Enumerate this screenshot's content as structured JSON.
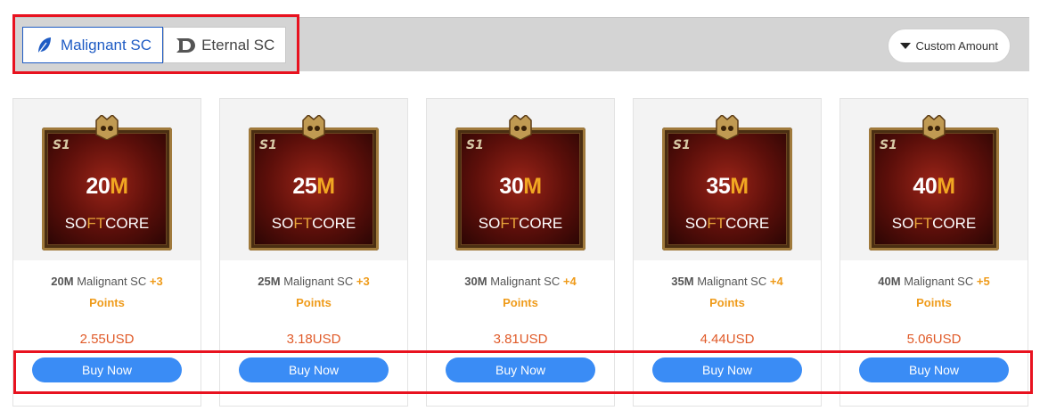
{
  "tabs": [
    {
      "label": "Malignant SC",
      "icon": "leaf-icon",
      "active": true
    },
    {
      "label": "Eternal SC",
      "icon": "diablo-d-icon",
      "active": false
    }
  ],
  "custom_amount": {
    "label": "Custom Amount",
    "icon": "caret-down-icon"
  },
  "colors": {
    "accent": "#3a8cf5",
    "tab_active": "#1f5cc4",
    "price": "#e05a28",
    "points": "#ef9b1a",
    "highlight": "#e8121f"
  },
  "products": [
    {
      "art_season": "S1",
      "art_amount_num": "20",
      "art_amount_unit": "M",
      "art_label_a": "SO",
      "art_label_b": "FT",
      "art_label_c": "CORE",
      "amount": "20M",
      "name": "Malignant SC",
      "bonus": "+3",
      "points_label": "Points",
      "price": "2.55USD",
      "buy_label": "Buy Now"
    },
    {
      "art_season": "S1",
      "art_amount_num": "25",
      "art_amount_unit": "M",
      "art_label_a": "SO",
      "art_label_b": "FT",
      "art_label_c": "CORE",
      "amount": "25M",
      "name": "Malignant SC",
      "bonus": "+3",
      "points_label": "Points",
      "price": "3.18USD",
      "buy_label": "Buy Now"
    },
    {
      "art_season": "S1",
      "art_amount_num": "30",
      "art_amount_unit": "M",
      "art_label_a": "SO",
      "art_label_b": "FT",
      "art_label_c": "CORE",
      "amount": "30M",
      "name": "Malignant SC",
      "bonus": "+4",
      "points_label": "Points",
      "price": "3.81USD",
      "buy_label": "Buy Now"
    },
    {
      "art_season": "S1",
      "art_amount_num": "35",
      "art_amount_unit": "M",
      "art_label_a": "SO",
      "art_label_b": "FT",
      "art_label_c": "CORE",
      "amount": "35M",
      "name": "Malignant SC",
      "bonus": "+4",
      "points_label": "Points",
      "price": "4.44USD",
      "buy_label": "Buy Now"
    },
    {
      "art_season": "S1",
      "art_amount_num": "40",
      "art_amount_unit": "M",
      "art_label_a": "SO",
      "art_label_b": "FT",
      "art_label_c": "CORE",
      "amount": "40M",
      "name": "Malignant SC",
      "bonus": "+5",
      "points_label": "Points",
      "price": "5.06USD",
      "buy_label": "Buy Now"
    }
  ]
}
